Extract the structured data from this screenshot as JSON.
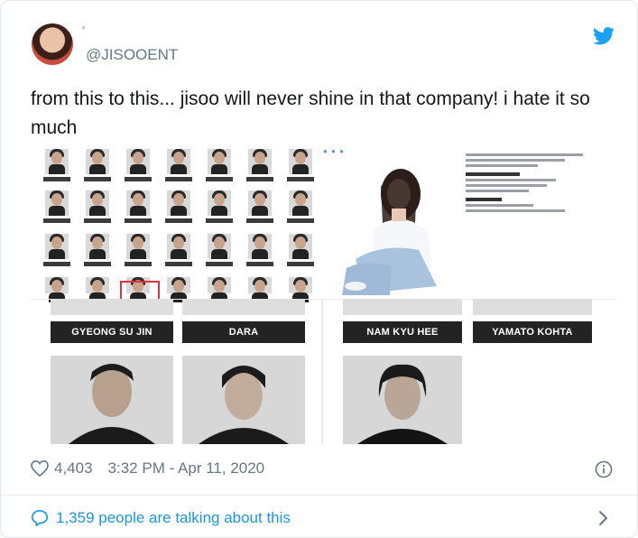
{
  "tweet": {
    "handle": "@JISOOENT",
    "text": "from this to this... jisoo will never shine in that company! i hate it so much",
    "likes": "4,403",
    "time": "3:32 PM - Apr 11, 2020",
    "conversation": "1,359 people are talking about this"
  },
  "media": {
    "name_labels": [
      "GYEONG SU JIN",
      "DARA",
      "NAM KYU HEE",
      "YAMATO KOHTA"
    ]
  },
  "colors": {
    "twitter_blue": "#1da1f2",
    "link_blue": "#1b95e0",
    "meta_gray": "#657786"
  },
  "icons": [
    "twitter-bird-icon",
    "heart-icon",
    "info-icon",
    "speech-bubble-icon",
    "chevron-right-icon"
  ]
}
